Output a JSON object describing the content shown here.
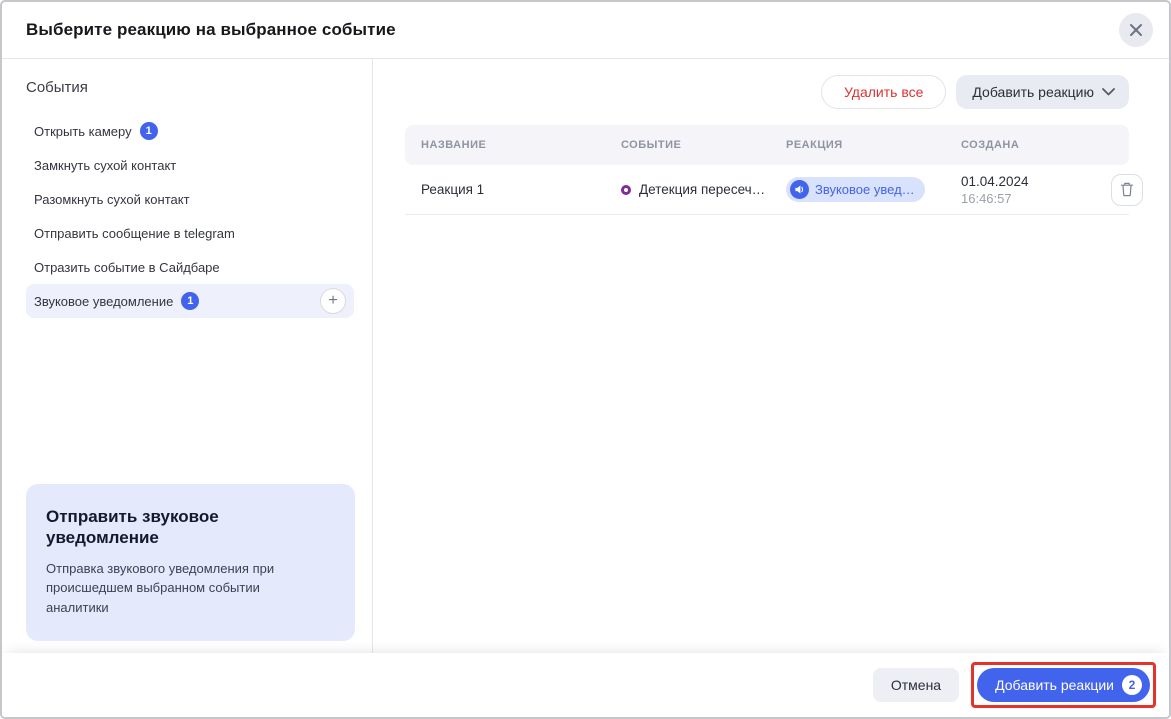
{
  "colors": {
    "accent": "#4263eb",
    "danger": "#e03131",
    "highlight": "#e5322d",
    "chip-bg": "#d9e2fc"
  },
  "modal": {
    "title": "Выберите реакцию на выбранное событие"
  },
  "sidebar": {
    "heading": "События",
    "items": [
      {
        "label": "Открыть камеру",
        "badge": "1"
      },
      {
        "label": "Замкнуть сухой контакт"
      },
      {
        "label": "Разомкнуть сухой контакт"
      },
      {
        "label": "Отправить сообщение в telegram"
      },
      {
        "label": "Отразить событие в Сайдбаре"
      },
      {
        "label": "Звуковое уведомление",
        "badge": "1"
      }
    ],
    "info": {
      "title": "Отправить звуковое уведомление",
      "description": "Отправка звукового уведомления при происшедшем выбранном событии аналитики"
    }
  },
  "toolbar": {
    "delete_all_label": "Удалить все",
    "add_reaction_label": "Добавить реакцию"
  },
  "table": {
    "headers": [
      "НАЗВАНИЕ",
      "СОБЫТИЕ",
      "РЕАКЦИЯ",
      "СОЗДАНА"
    ],
    "rows": [
      {
        "name": "Реакция 1",
        "event": "Детекция пересеч…",
        "reaction": "Звуковое увед…",
        "date": "01.04.2024",
        "time": "16:46:57"
      }
    ]
  },
  "footer": {
    "cancel_label": "Отмена",
    "submit_label": "Добавить реакции",
    "submit_badge": "2"
  }
}
